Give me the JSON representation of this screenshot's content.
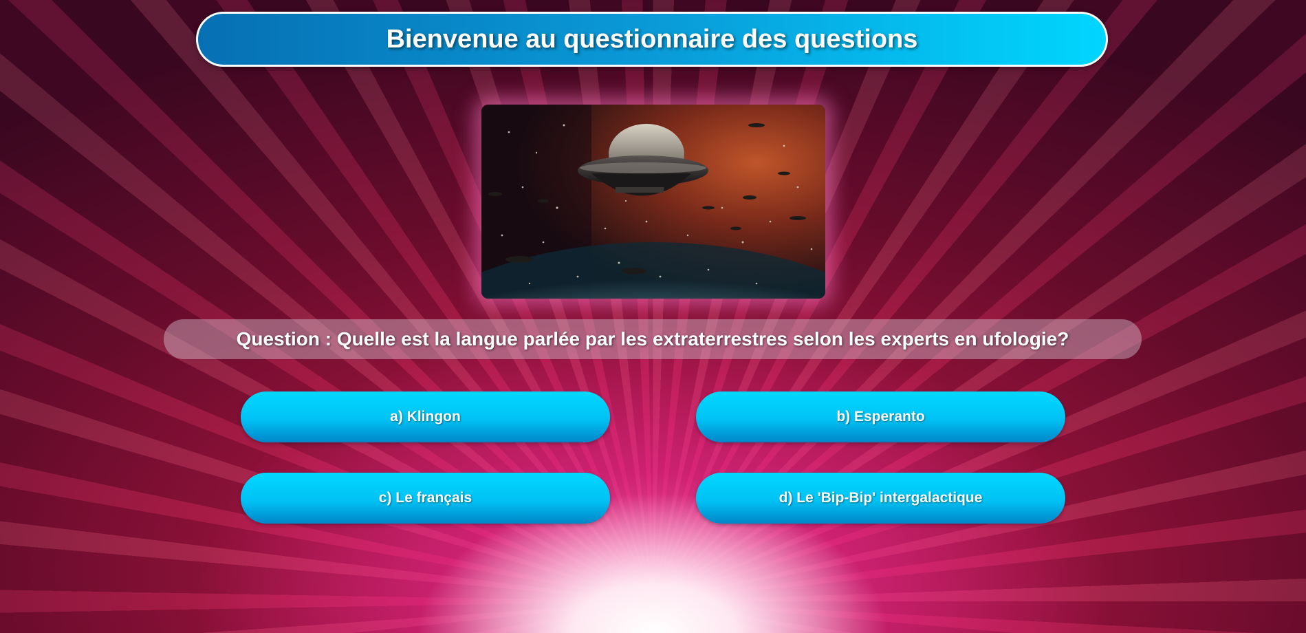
{
  "header": {
    "title": "Bienvenue au questionnaire des questions"
  },
  "media": {
    "image_subject": "ufo-spaceship-image"
  },
  "question": {
    "text": "Question : Quelle est la langue parlée par les extraterrestres selon les experts en ufologie?"
  },
  "answers": [
    {
      "label": "a) Klingon"
    },
    {
      "label": "b) Esperanto"
    },
    {
      "label": "c) Le français"
    },
    {
      "label": "d) Le 'Bip-Bip' intergalactique"
    }
  ],
  "colors": {
    "title_gradient_start": "#0670b3",
    "title_gradient_end": "#00d6ff",
    "button_top": "#00d8ff",
    "button_bottom": "#0085c8",
    "background_core": "#d8246e"
  }
}
